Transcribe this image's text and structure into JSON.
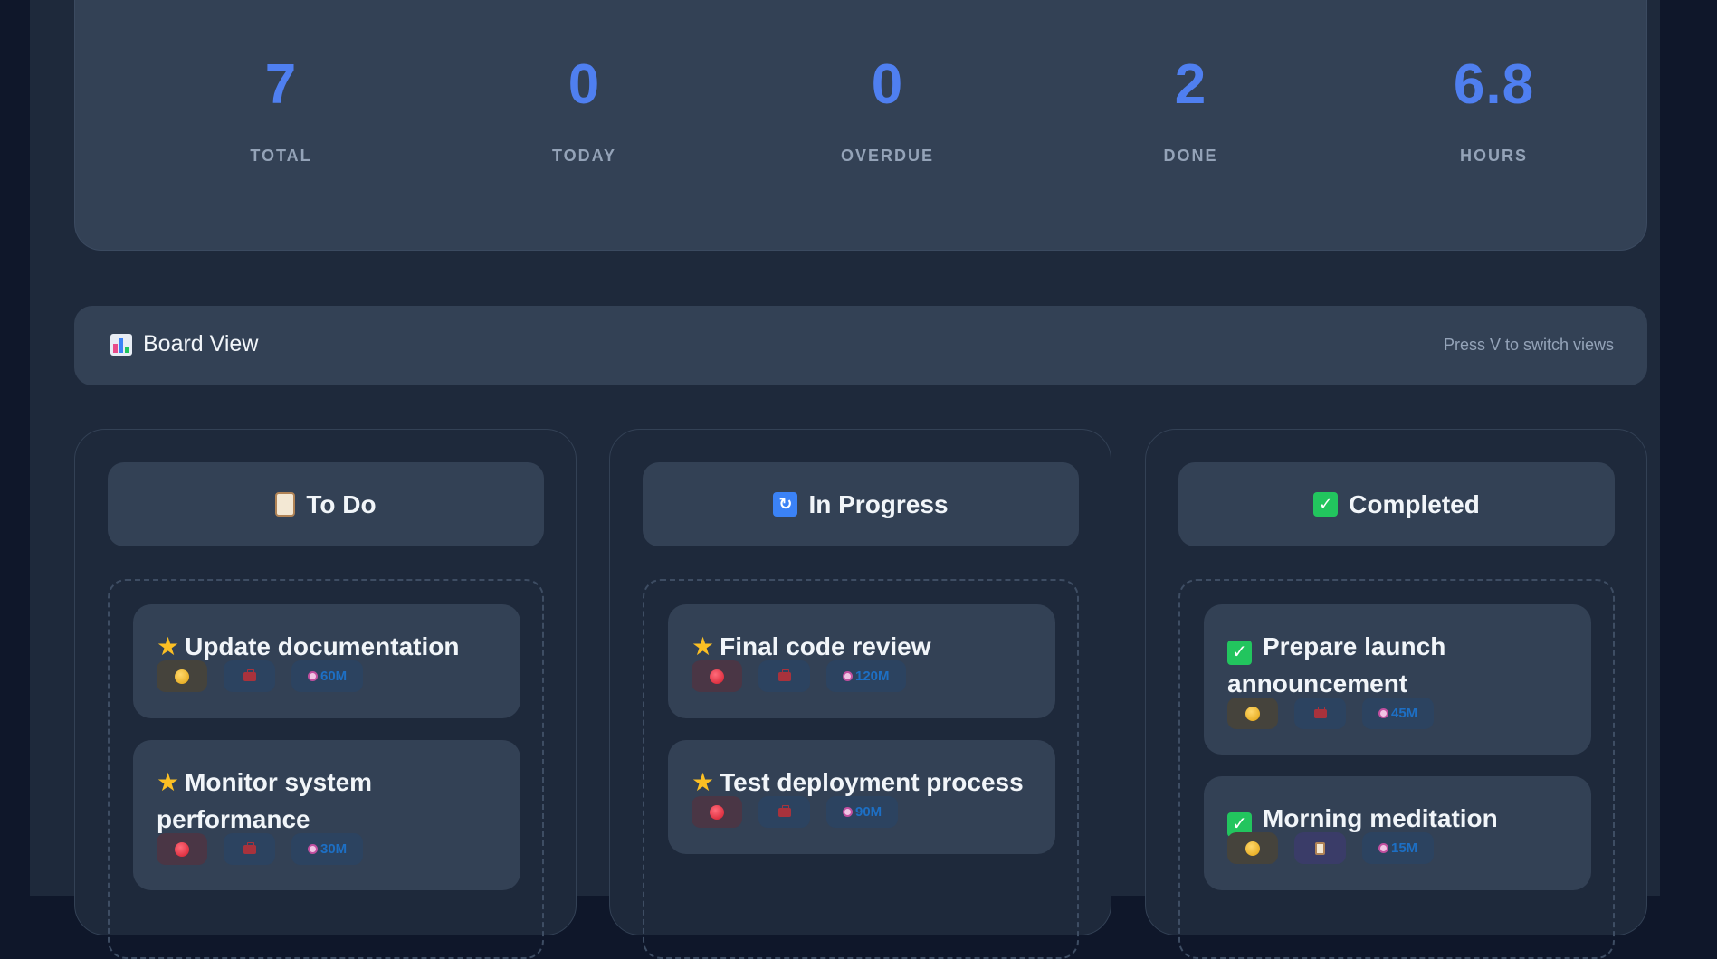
{
  "stats": [
    {
      "value": "7",
      "label": "TOTAL"
    },
    {
      "value": "0",
      "label": "TODAY"
    },
    {
      "value": "0",
      "label": "OVERDUE"
    },
    {
      "value": "2",
      "label": "DONE"
    },
    {
      "value": "6.8",
      "label": "HOURS"
    }
  ],
  "viewbar": {
    "title": "Board View",
    "icon": "bar-chart-icon",
    "hint": "Press V to switch views"
  },
  "columns": [
    {
      "title": "To Do",
      "icon": "clipboard-icon",
      "tasks": [
        {
          "title": "Update documentation",
          "icon": "star-icon",
          "priority": "medium",
          "category": "work",
          "time": "60M"
        },
        {
          "title": "Monitor system performance",
          "icon": "star-icon",
          "priority": "high",
          "category": "work",
          "time": "30M"
        }
      ]
    },
    {
      "title": "In Progress",
      "icon": "refresh-icon",
      "tasks": [
        {
          "title": "Final code review",
          "icon": "star-icon",
          "priority": "high",
          "category": "work",
          "time": "120M"
        },
        {
          "title": "Test deployment process",
          "icon": "star-icon",
          "priority": "high",
          "category": "work",
          "time": "90M"
        }
      ]
    },
    {
      "title": "Completed",
      "icon": "check-icon",
      "tasks": [
        {
          "title": "Prepare launch announcement",
          "icon": "check-icon",
          "priority": "medium",
          "category": "work",
          "time": "45M"
        },
        {
          "title": "Morning meditation",
          "icon": "check-icon",
          "priority": "medium",
          "category": "personal",
          "time": "15M"
        }
      ]
    }
  ],
  "colors": {
    "accent": "#4f7ff0",
    "panel": "#334155",
    "background": "#1e293b",
    "completed": "#22c55e",
    "star": "#fbbf24"
  }
}
